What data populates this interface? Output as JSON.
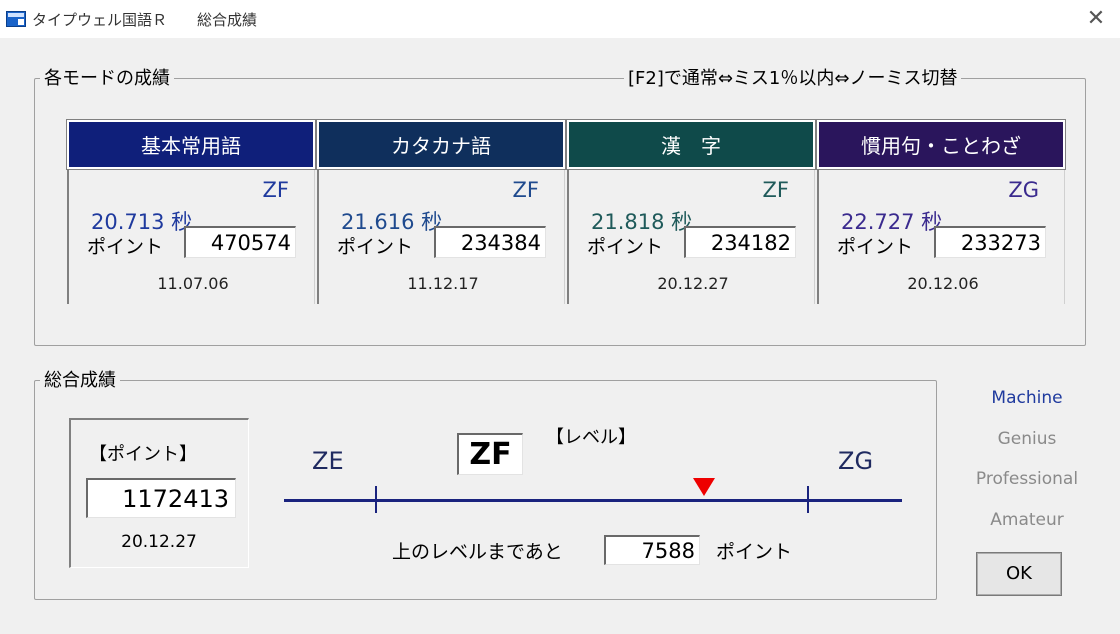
{
  "window": {
    "title": "タイプウェル国語Ｒ　　総合成績",
    "close_label": "✕"
  },
  "modes_group": {
    "label": "各モードの成績",
    "toggle_hint": "[F2]で通常⇔ミス1％以内⇔ノーミス切替",
    "point_label": "ポイント",
    "modes": [
      {
        "name": "基本常用語",
        "time": "20.713 秒",
        "level": "ZF",
        "points": "470574",
        "date": "11.07.06",
        "color": "#0f1f7a"
      },
      {
        "name": "カタカナ語",
        "time": "21.616 秒",
        "level": "ZF",
        "points": "234384",
        "date": "11.12.17",
        "color": "#0f2f5c"
      },
      {
        "name": "漢　字",
        "time": "21.818 秒",
        "level": "ZF",
        "points": "234182",
        "date": "20.12.27",
        "color": "#0f4a4a"
      },
      {
        "name": "慣用句・ことわざ",
        "time": "22.727 秒",
        "level": "ZG",
        "points": "233273",
        "date": "20.12.06",
        "color": "#2a155c"
      }
    ]
  },
  "overall": {
    "label": "総合成績",
    "point_label": "【ポイント】",
    "points": "1172413",
    "date": "20.12.27",
    "level_label": "【レベル】",
    "level": "ZF",
    "scale_left": "ZE",
    "scale_right": "ZG",
    "progress_fraction": 0.76,
    "remain_label": "上のレベルまであと",
    "remain_value": "7588",
    "remain_unit": "ポイント"
  },
  "ranks": [
    {
      "label": "Machine",
      "active": true
    },
    {
      "label": "Genius",
      "active": false
    },
    {
      "label": "Professional",
      "active": false
    },
    {
      "label": "Amateur",
      "active": false
    }
  ],
  "ok_label": "OK"
}
